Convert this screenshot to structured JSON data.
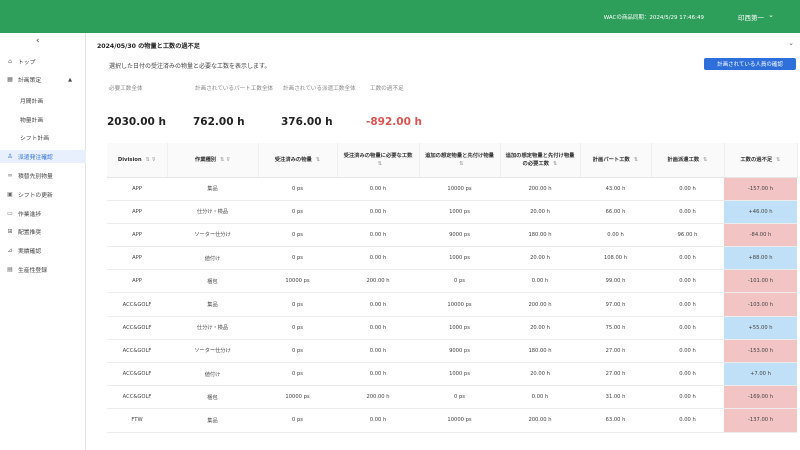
{
  "header": {
    "sync_text": "WACの商品同期：2024/5/29 17:46:49",
    "user_name": "印西第一"
  },
  "sidebar": {
    "items": [
      {
        "label": "トップ",
        "icon": "home-icon"
      },
      {
        "label": "計画策定",
        "icon": "calendar-icon"
      },
      {
        "label": "月間計画",
        "icon": ""
      },
      {
        "label": "物量計画",
        "icon": ""
      },
      {
        "label": "シフト計画",
        "icon": ""
      },
      {
        "label": "派遣発注確認",
        "icon": "people-icon"
      },
      {
        "label": "積替先別物量",
        "icon": "link-icon"
      },
      {
        "label": "シフトの更新",
        "icon": "refresh-icon"
      },
      {
        "label": "作業進捗",
        "icon": "monitor-icon"
      },
      {
        "label": "配置推奨",
        "icon": "grid-icon"
      },
      {
        "label": "実績確認",
        "icon": "chart-icon"
      },
      {
        "label": "生産性登録",
        "icon": "table-icon"
      }
    ]
  },
  "main": {
    "title": "2024/05/30 の物量と工数の過不足",
    "description": "選択した日付の受注済みの物量と必要な工数を表示します。",
    "confirm_button": "計画されている人員の確認"
  },
  "kpis": [
    {
      "label": "必要工数全体",
      "value": "2030.00 h"
    },
    {
      "label": "計画されているパート工数全体",
      "value": "762.00 h"
    },
    {
      "label": "計画されている派遣工数全体",
      "value": "376.00 h"
    },
    {
      "label": "工数の過不足",
      "value": "-892.00 h"
    }
  ],
  "table": {
    "headers": [
      "Division",
      "作業種別",
      "受注済みの物量",
      "受注済みの物量に必要な工数",
      "追加の想定物量と先付け物量",
      "追加の想定物量と先付け物量の必要工数",
      "計画パート工数",
      "計画派遣工数",
      "工数の過不足"
    ],
    "rows": [
      {
        "division": "APP",
        "work": "集品",
        "ordered": "0 ps",
        "ordered_hours": "0.00 h",
        "extra": "10000 ps",
        "extra_hours": "200.00 h",
        "part": "43.00 h",
        "dispatch": "0.00 h",
        "balance": "-157.00 h",
        "sign": "neg"
      },
      {
        "division": "APP",
        "work": "仕分け・検品",
        "ordered": "0 ps",
        "ordered_hours": "0.00 h",
        "extra": "1000 ps",
        "extra_hours": "20.00 h",
        "part": "66.00 h",
        "dispatch": "0.00 h",
        "balance": "+46.00 h",
        "sign": "pos"
      },
      {
        "division": "APP",
        "work": "ソーター仕分け",
        "ordered": "0 ps",
        "ordered_hours": "0.00 h",
        "extra": "9000 ps",
        "extra_hours": "180.00 h",
        "part": "0.00 h",
        "dispatch": "96.00 h",
        "balance": "-84.00 h",
        "sign": "neg"
      },
      {
        "division": "APP",
        "work": "値付け",
        "ordered": "0 ps",
        "ordered_hours": "0.00 h",
        "extra": "1000 ps",
        "extra_hours": "20.00 h",
        "part": "108.00 h",
        "dispatch": "0.00 h",
        "balance": "+88.00 h",
        "sign": "pos"
      },
      {
        "division": "APP",
        "work": "梱包",
        "ordered": "10000 ps",
        "ordered_hours": "200.00 h",
        "extra": "0 ps",
        "extra_hours": "0.00 h",
        "part": "99.00 h",
        "dispatch": "0.00 h",
        "balance": "-101.00 h",
        "sign": "neg"
      },
      {
        "division": "ACC&GOLF",
        "work": "集品",
        "ordered": "0 ps",
        "ordered_hours": "0.00 h",
        "extra": "10000 ps",
        "extra_hours": "200.00 h",
        "part": "97.00 h",
        "dispatch": "0.00 h",
        "balance": "-103.00 h",
        "sign": "neg"
      },
      {
        "division": "ACC&GOLF",
        "work": "仕分け・検品",
        "ordered": "0 ps",
        "ordered_hours": "0.00 h",
        "extra": "1000 ps",
        "extra_hours": "20.00 h",
        "part": "75.00 h",
        "dispatch": "0.00 h",
        "balance": "+55.00 h",
        "sign": "pos"
      },
      {
        "division": "ACC&GOLF",
        "work": "ソーター仕分け",
        "ordered": "0 ps",
        "ordered_hours": "0.00 h",
        "extra": "9000 ps",
        "extra_hours": "180.00 h",
        "part": "27.00 h",
        "dispatch": "0.00 h",
        "balance": "-153.00 h",
        "sign": "neg"
      },
      {
        "division": "ACC&GOLF",
        "work": "値付け",
        "ordered": "0 ps",
        "ordered_hours": "0.00 h",
        "extra": "1000 ps",
        "extra_hours": "20.00 h",
        "part": "27.00 h",
        "dispatch": "0.00 h",
        "balance": "+7.00 h",
        "sign": "pos"
      },
      {
        "division": "ACC&GOLF",
        "work": "梱包",
        "ordered": "10000 ps",
        "ordered_hours": "200.00 h",
        "extra": "0 ps",
        "extra_hours": "0.00 h",
        "part": "31.00 h",
        "dispatch": "0.00 h",
        "balance": "-169.00 h",
        "sign": "neg"
      },
      {
        "division": "FTW",
        "work": "集品",
        "ordered": "0 ps",
        "ordered_hours": "0.00 h",
        "extra": "10000 ps",
        "extra_hours": "200.00 h",
        "part": "63.00 h",
        "dispatch": "0.00 h",
        "balance": "-137.00 h",
        "sign": "neg"
      }
    ]
  },
  "colors": {
    "header_bg": "#2e9e5b",
    "accent": "#2f6fdb",
    "negative_cell": "#f2c4c4",
    "positive_cell": "#bfe0f6",
    "negative_text": "#e05252"
  }
}
